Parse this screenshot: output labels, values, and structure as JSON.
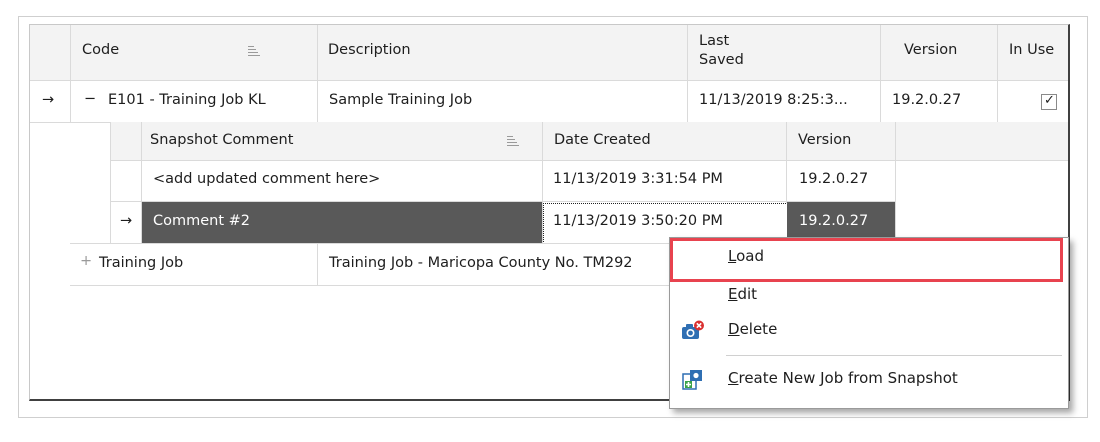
{
  "grid": {
    "headers": {
      "code": "Code",
      "description": "Description",
      "last_saved_line1": "Last",
      "last_saved_line2": "Saved",
      "version": "Version",
      "in_use": "In Use"
    },
    "rows": [
      {
        "expander": "−",
        "code": "E101 - Training Job KL",
        "description": "Sample Training Job",
        "last_saved": "11/13/2019 8:25:3...",
        "version": "19.2.0.27",
        "in_use": true
      },
      {
        "expander": "+",
        "code": "Training Job",
        "description": "Training Job - Maricopa County No. TM292"
      }
    ]
  },
  "detail": {
    "headers": {
      "comment": "Snapshot Comment",
      "date_created": "Date Created",
      "version": "Version"
    },
    "rows": [
      {
        "comment": "<add updated comment here>",
        "date_created": "11/13/2019 3:31:54 PM",
        "version": "19.2.0.27"
      },
      {
        "comment": "Comment #2",
        "date_created": "11/13/2019 3:50:20 PM",
        "version": "19.2.0.27"
      }
    ]
  },
  "row_pointer": "→",
  "check_mark": "✓",
  "context_menu": {
    "items": [
      {
        "label": "Load",
        "mnemonic": "L",
        "rest": "oad",
        "icon": "none"
      },
      {
        "label": "Edit",
        "mnemonic": "E",
        "rest": "dit",
        "icon": "none"
      },
      {
        "label": "Delete",
        "mnemonic": "D",
        "rest": "elete",
        "icon": "camera-delete-icon"
      },
      {
        "label": "Create New Job from Snapshot",
        "mnemonic": "C",
        "rest": "reate New Job from Snapshot",
        "icon": "create-job-icon"
      }
    ],
    "highlight_color": "#e8434f"
  },
  "colors": {
    "selected_row": "#595959",
    "header_bg": "#f3f3f3"
  }
}
